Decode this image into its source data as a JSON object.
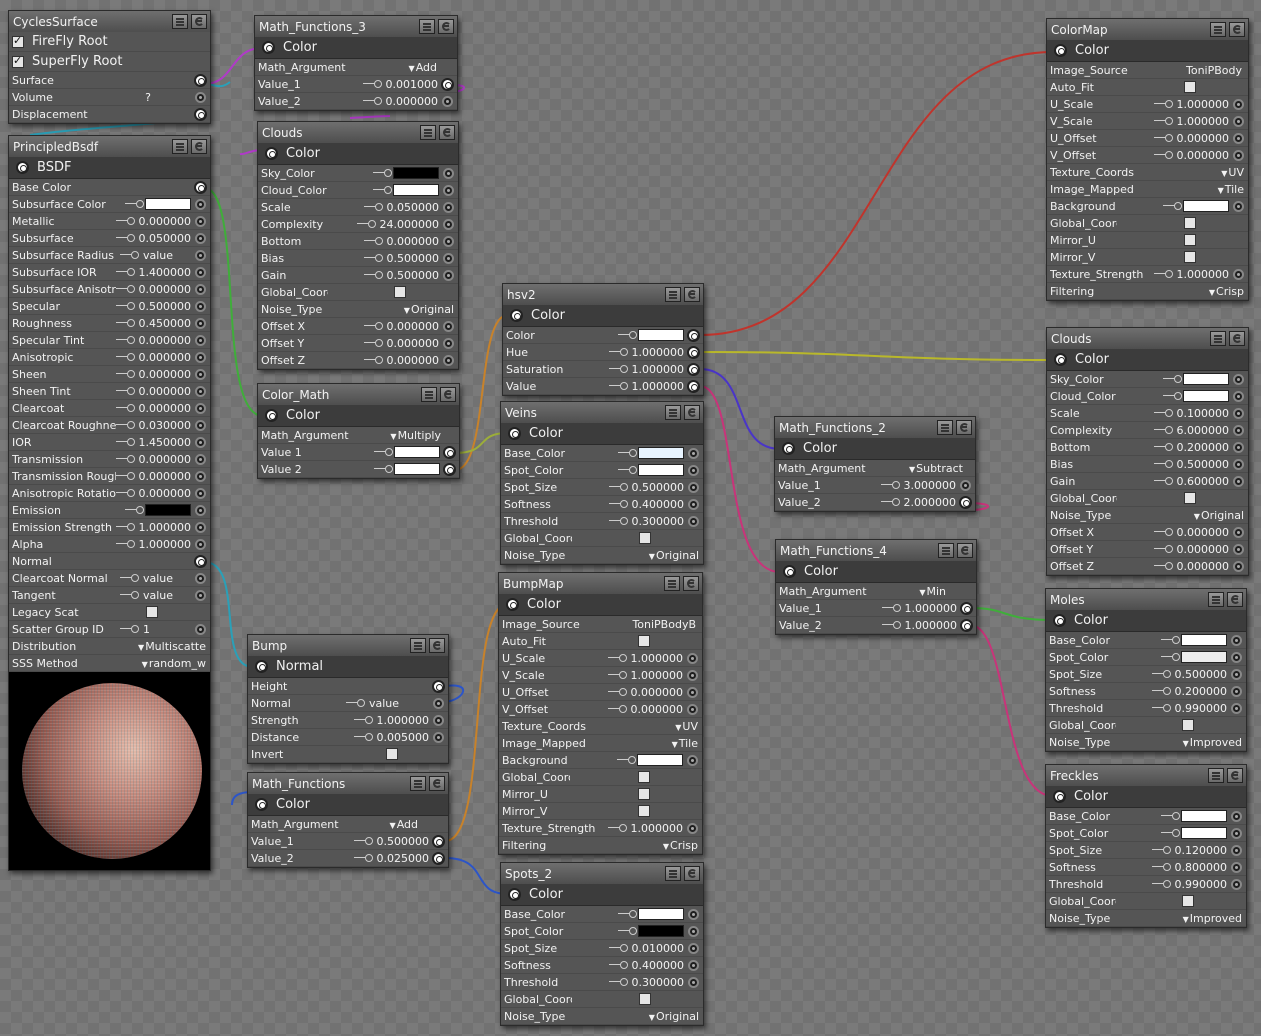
{
  "nodes": {
    "cycles_surface": {
      "title": "CyclesSurface",
      "checks": [
        {
          "label": "FireFly Root",
          "checked": true
        },
        {
          "label": "SuperFly Root",
          "checked": true
        }
      ],
      "inputs": [
        {
          "label": "Surface",
          "value": ""
        },
        {
          "label": "Volume",
          "value": "?"
        },
        {
          "label": "Displacement",
          "value": ""
        }
      ]
    },
    "principled_bsdf": {
      "title": "PrincipledBsdf",
      "output": "BSDF",
      "rows": [
        {
          "label": "Base Color",
          "value": ""
        },
        {
          "label": "Subsurface Color",
          "value": "",
          "swatch": "white"
        },
        {
          "label": "Metallic",
          "value": "0.000000"
        },
        {
          "label": "Subsurface",
          "value": "0.050000"
        },
        {
          "label": "Subsurface Radius",
          "value": "value"
        },
        {
          "label": "Subsurface IOR",
          "value": "1.400000"
        },
        {
          "label": "Subsurface Anisotropy",
          "value": "0.000000"
        },
        {
          "label": "Specular",
          "value": "0.500000"
        },
        {
          "label": "Roughness",
          "value": "0.450000"
        },
        {
          "label": "Specular Tint",
          "value": "0.000000"
        },
        {
          "label": "Anisotropic",
          "value": "0.000000"
        },
        {
          "label": "Sheen",
          "value": "0.000000"
        },
        {
          "label": "Sheen Tint",
          "value": "0.000000"
        },
        {
          "label": "Clearcoat",
          "value": "0.000000"
        },
        {
          "label": "Clearcoat Roughness",
          "value": "0.030000"
        },
        {
          "label": "IOR",
          "value": "1.450000"
        },
        {
          "label": "Transmission",
          "value": "0.000000"
        },
        {
          "label": "Transmission Roughness",
          "value": "0.000000"
        },
        {
          "label": "Anisotropic Rotation",
          "value": "0.000000"
        },
        {
          "label": "Emission",
          "value": "",
          "swatch": "black"
        },
        {
          "label": "Emission Strength",
          "value": "1.000000"
        },
        {
          "label": "Alpha",
          "value": "1.000000"
        },
        {
          "label": "Normal",
          "value": ""
        },
        {
          "label": "Clearcoat Normal",
          "value": "value"
        },
        {
          "label": "Tangent",
          "value": "value"
        },
        {
          "label": "Legacy Scatter",
          "value": "",
          "checkbox": true
        },
        {
          "label": "Scatter Group ID",
          "value": "1"
        },
        {
          "label": "Distribution",
          "value": "Multiscatte",
          "dropdown": true
        },
        {
          "label": "SSS Method",
          "value": "random_w",
          "dropdown": true
        }
      ]
    },
    "math3": {
      "title": "Math_Functions_3",
      "output": "Color",
      "arg_label": "Math_Argument",
      "arg_value": "Add",
      "v1_label": "Value_1",
      "v1": "0.001000",
      "v2_label": "Value_2",
      "v2": "0.000000"
    },
    "clouds_mid": {
      "title": "Clouds",
      "output": "Color",
      "rows": [
        {
          "label": "Sky_Color",
          "value": "",
          "swatch": "black"
        },
        {
          "label": "Cloud_Color",
          "value": "",
          "swatch": "white"
        },
        {
          "label": "Scale",
          "value": "0.050000"
        },
        {
          "label": "Complexity",
          "value": "24.000000"
        },
        {
          "label": "Bottom",
          "value": "0.000000"
        },
        {
          "label": "Bias",
          "value": "0.500000"
        },
        {
          "label": "Gain",
          "value": "0.500000"
        },
        {
          "label": "Global_Coordinates",
          "value": "",
          "checkbox": true
        },
        {
          "label": "Noise_Type",
          "value": "Original",
          "dropdown": true
        },
        {
          "label": "Offset X",
          "value": "0.000000"
        },
        {
          "label": "Offset Y",
          "value": "0.000000"
        },
        {
          "label": "Offset Z",
          "value": "0.000000"
        }
      ]
    },
    "color_math": {
      "title": "Color_Math",
      "output": "Color",
      "arg_label": "Math_Argument",
      "arg_value": "Multiply",
      "v1_label": "Value 1",
      "v2_label": "Value 2"
    },
    "bump": {
      "title": "Bump",
      "output": "Normal",
      "height": "Height",
      "normal_label": "Normal",
      "normal_value": "value",
      "strength_label": "Strength",
      "strength": "1.000000",
      "distance_label": "Distance",
      "distance": "0.005000",
      "invert": "Invert"
    },
    "math1": {
      "title": "Math_Functions",
      "output": "Color",
      "arg_label": "Math_Argument",
      "arg_value": "Add",
      "v1_label": "Value_1",
      "v1": "0.500000",
      "v2_label": "Value_2",
      "v2": "0.025000"
    },
    "hsv2": {
      "title": "hsv2",
      "output": "Color",
      "color": "Color",
      "hue_label": "Hue",
      "hue": "1.000000",
      "sat_label": "Saturation",
      "sat": "1.000000",
      "val_label": "Value",
      "val": "1.000000"
    },
    "veins": {
      "title": "Veins",
      "output": "Color",
      "rows": [
        {
          "label": "Base_Color",
          "value": "",
          "swatch": "lblue"
        },
        {
          "label": "Spot_Color",
          "value": "",
          "swatch": "white"
        },
        {
          "label": "Spot_Size",
          "value": "0.500000"
        },
        {
          "label": "Softness",
          "value": "0.400000"
        },
        {
          "label": "Threshold",
          "value": "0.300000"
        },
        {
          "label": "Global_Coordinates",
          "value": "",
          "checkbox": true
        },
        {
          "label": "Noise_Type",
          "value": "Original",
          "dropdown": true
        }
      ]
    },
    "bumpmap": {
      "title": "BumpMap",
      "output": "Color",
      "rows": [
        {
          "label": "Image_Source",
          "value": "ToniPBodyB"
        },
        {
          "label": "Auto_Fit",
          "value": "",
          "checkbox": true
        },
        {
          "label": "U_Scale",
          "value": "1.000000"
        },
        {
          "label": "V_Scale",
          "value": "1.000000"
        },
        {
          "label": "U_Offset",
          "value": "0.000000"
        },
        {
          "label": "V_Offset",
          "value": "0.000000"
        },
        {
          "label": "Texture_Coords",
          "value": "UV",
          "dropdown": true
        },
        {
          "label": "Image_Mapped",
          "value": "Tile",
          "dropdown": true
        },
        {
          "label": "Background",
          "value": "",
          "swatch": "white"
        },
        {
          "label": "Global_Coordinates",
          "value": "",
          "checkbox": true
        },
        {
          "label": "Mirror_U",
          "value": "",
          "checkbox": true
        },
        {
          "label": "Mirror_V",
          "value": "",
          "checkbox": true
        },
        {
          "label": "Texture_Strength",
          "value": "1.000000"
        },
        {
          "label": "Filtering",
          "value": "Crisp",
          "dropdown": true
        }
      ]
    },
    "spots2": {
      "title": "Spots_2",
      "output": "Color",
      "rows": [
        {
          "label": "Base_Color",
          "value": "",
          "swatch": "white"
        },
        {
          "label": "Spot_Color",
          "value": "",
          "swatch": "black"
        },
        {
          "label": "Spot_Size",
          "value": "0.010000"
        },
        {
          "label": "Softness",
          "value": "0.400000"
        },
        {
          "label": "Threshold",
          "value": "0.300000"
        },
        {
          "label": "Global_Coordinates",
          "value": "",
          "checkbox": true
        },
        {
          "label": "Noise_Type",
          "value": "Original",
          "dropdown": true
        }
      ]
    },
    "math2": {
      "title": "Math_Functions_2",
      "output": "Color",
      "arg_label": "Math_Argument",
      "arg_value": "Subtract",
      "v1_label": "Value_1",
      "v1": "3.000000",
      "v2_label": "Value_2",
      "v2": "2.000000"
    },
    "math4": {
      "title": "Math_Functions_4",
      "output": "Color",
      "arg_label": "Math_Argument",
      "arg_value": "Min",
      "v1_label": "Value_1",
      "v1": "1.000000",
      "v2_label": "Value_2",
      "v2": "1.000000"
    },
    "colormap": {
      "title": "ColorMap",
      "output": "Color",
      "rows": [
        {
          "label": "Image_Source",
          "value": "ToniPBody"
        },
        {
          "label": "Auto_Fit",
          "value": "",
          "checkbox": true
        },
        {
          "label": "U_Scale",
          "value": "1.000000"
        },
        {
          "label": "V_Scale",
          "value": "1.000000"
        },
        {
          "label": "U_Offset",
          "value": "0.000000"
        },
        {
          "label": "V_Offset",
          "value": "0.000000"
        },
        {
          "label": "Texture_Coords",
          "value": "UV",
          "dropdown": true
        },
        {
          "label": "Image_Mapped",
          "value": "Tile",
          "dropdown": true
        },
        {
          "label": "Background",
          "value": "",
          "swatch": "white"
        },
        {
          "label": "Global_Coordinates",
          "value": "",
          "checkbox": true
        },
        {
          "label": "Mirror_U",
          "value": "",
          "checkbox": true
        },
        {
          "label": "Mirror_V",
          "value": "",
          "checkbox": true
        },
        {
          "label": "Texture_Strength",
          "value": "1.000000"
        },
        {
          "label": "Filtering",
          "value": "Crisp",
          "dropdown": true
        }
      ]
    },
    "clouds_right": {
      "title": "Clouds",
      "output": "Color",
      "rows": [
        {
          "label": "Sky_Color",
          "value": "",
          "swatch": "white"
        },
        {
          "label": "Cloud_Color",
          "value": "",
          "swatch": "white"
        },
        {
          "label": "Scale",
          "value": "0.100000"
        },
        {
          "label": "Complexity",
          "value": "6.000000"
        },
        {
          "label": "Bottom",
          "value": "0.200000"
        },
        {
          "label": "Bias",
          "value": "0.500000"
        },
        {
          "label": "Gain",
          "value": "0.600000"
        },
        {
          "label": "Global_Coordinates",
          "value": "",
          "checkbox": true
        },
        {
          "label": "Noise_Type",
          "value": "Original",
          "dropdown": true
        },
        {
          "label": "Offset X",
          "value": "0.000000"
        },
        {
          "label": "Offset Y",
          "value": "0.000000"
        },
        {
          "label": "Offset Z",
          "value": "0.000000"
        }
      ]
    },
    "moles": {
      "title": "Moles",
      "output": "Color",
      "rows": [
        {
          "label": "Base_Color",
          "value": "",
          "swatch": "white"
        },
        {
          "label": "Spot_Color",
          "value": "",
          "swatch": "lgrey"
        },
        {
          "label": "Spot_Size",
          "value": "0.500000"
        },
        {
          "label": "Softness",
          "value": "0.200000"
        },
        {
          "label": "Threshold",
          "value": "0.990000"
        },
        {
          "label": "Global_Coordinates",
          "value": "",
          "checkbox": true
        },
        {
          "label": "Noise_Type",
          "value": "Improved",
          "dropdown": true
        }
      ]
    },
    "freckles": {
      "title": "Freckles",
      "output": "Color",
      "rows": [
        {
          "label": "Base_Color",
          "value": "",
          "swatch": "white"
        },
        {
          "label": "Spot_Color",
          "value": "",
          "swatch": "white"
        },
        {
          "label": "Spot_Size",
          "value": "0.120000"
        },
        {
          "label": "Softness",
          "value": "0.800000"
        },
        {
          "label": "Threshold",
          "value": "0.990000"
        },
        {
          "label": "Global_Coordinates",
          "value": "",
          "checkbox": true
        },
        {
          "label": "Noise_Type",
          "value": "Improved",
          "dropdown": true
        }
      ]
    }
  },
  "colors": {
    "wire_red": "#c0342c",
    "wire_yellow": "#b9b82a",
    "wire_green": "#3fae3a",
    "wire_orange": "#c8822a",
    "wire_blue": "#2c55c8",
    "wire_indigo": "#4a35c8",
    "wire_pink": "#c8347a",
    "wire_magenta": "#b03ac8",
    "wire_teal": "#2aa0b8"
  }
}
